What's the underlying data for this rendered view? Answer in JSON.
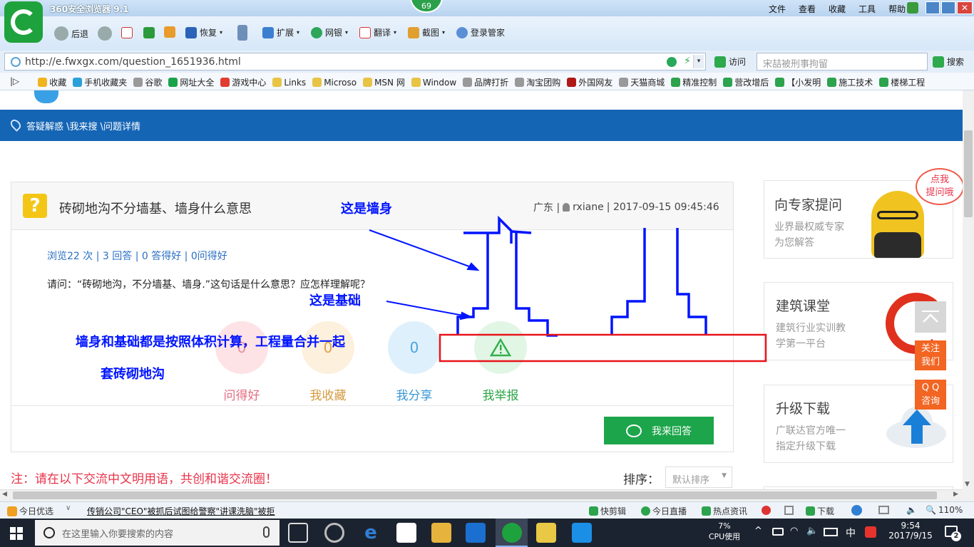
{
  "browser": {
    "title": "360安全浏览器 9.1",
    "badge": "69",
    "menu": [
      "文件",
      "查看",
      "收藏",
      "工具",
      "帮助"
    ],
    "nav": {
      "back": "后退",
      "restore": "恢复",
      "extensions": "扩展",
      "bank": "网银",
      "translate": "翻译",
      "screenshot": "截图",
      "login": "登录管家"
    },
    "address": "http://e.fwxgx.com/question_1651936.html",
    "go_label": "访问",
    "search_placeholder": "宋喆被刑事拘留",
    "search_label": "搜索",
    "bookmarks": [
      "收藏",
      "手机收藏夹",
      "谷歌",
      "网址大全",
      "游戏中心",
      "Links",
      "Microso",
      "MSN 网",
      "Window",
      "品牌打折",
      "淘宝团购",
      "外国网友",
      "天猫商城",
      "精准控制",
      "营改增后",
      "【小发明",
      "施工技术",
      "楼梯工程"
    ]
  },
  "page": {
    "breadcrumb": "答疑解惑 \\我来搜 \\问题详情",
    "question": {
      "title": "砖砌地沟不分墙基、墙身什么意思",
      "meta_region": "广东 |",
      "meta_user": "rxiane",
      "meta_time": "| 2017-09-15 09:45:46",
      "stats": "浏览22 次 | 3 回答 | 0 答得好 | 0问得好",
      "body": "请问：“砖砌地沟，不分墙基、墙身.”这句话是什么意思？应怎样理解呢？",
      "actions": [
        {
          "count": "0",
          "label": "问得好"
        },
        {
          "count": "0",
          "label": "我收藏"
        },
        {
          "count": "0",
          "label": "我分享"
        },
        {
          "count": "",
          "label": "我举报"
        }
      ],
      "answer_button": "我来回答"
    },
    "notice": "注：请在以下交流中文明用语，共创和谐交流圈！",
    "sort_label": "排序：",
    "sort_value": "默认排序",
    "annotations": {
      "wall_body": "这是墙身",
      "foundation": "这是基础",
      "note_line1": "墙身和基础都是按照体积计算，工程量合并一起",
      "note_line2": "套砖砌地沟"
    },
    "sidebar": [
      {
        "title": "向专家提问",
        "sub1": "业界最权威专家",
        "sub2": "为您解答",
        "bubble1": "点我",
        "bubble2": "提问哦"
      },
      {
        "title": "建筑课堂",
        "sub1": "建筑行业实训教",
        "sub2": "学第一平台"
      },
      {
        "title": "升级下载",
        "sub1": "广联达官方唯一",
        "sub2": "指定升级下载"
      }
    ],
    "float": {
      "follow1": "关注",
      "follow2": "我们",
      "qq1": "Q Q",
      "qq2": "咨询"
    }
  },
  "statusbar": {
    "today": "今日优选",
    "headline": "传销公司\"CEO\"被抓后试图给警察\"讲课洗脑\"被拒",
    "items": [
      "快剪辑",
      "今日直播",
      "热点资讯",
      "下载"
    ],
    "zoom": "110%"
  },
  "taskbar": {
    "search_placeholder": "在这里输入你要搜索的内容",
    "cpu_pct": "7%",
    "cpu_label": "CPU使用",
    "ime": "中",
    "time": "9:54",
    "date": "2017/9/15",
    "notif": "2"
  },
  "colors": {
    "brand_blue": "#1565b5",
    "accent_green": "#1ca54a",
    "annot_blue": "#0014ff",
    "annot_red": "#e8141b"
  }
}
